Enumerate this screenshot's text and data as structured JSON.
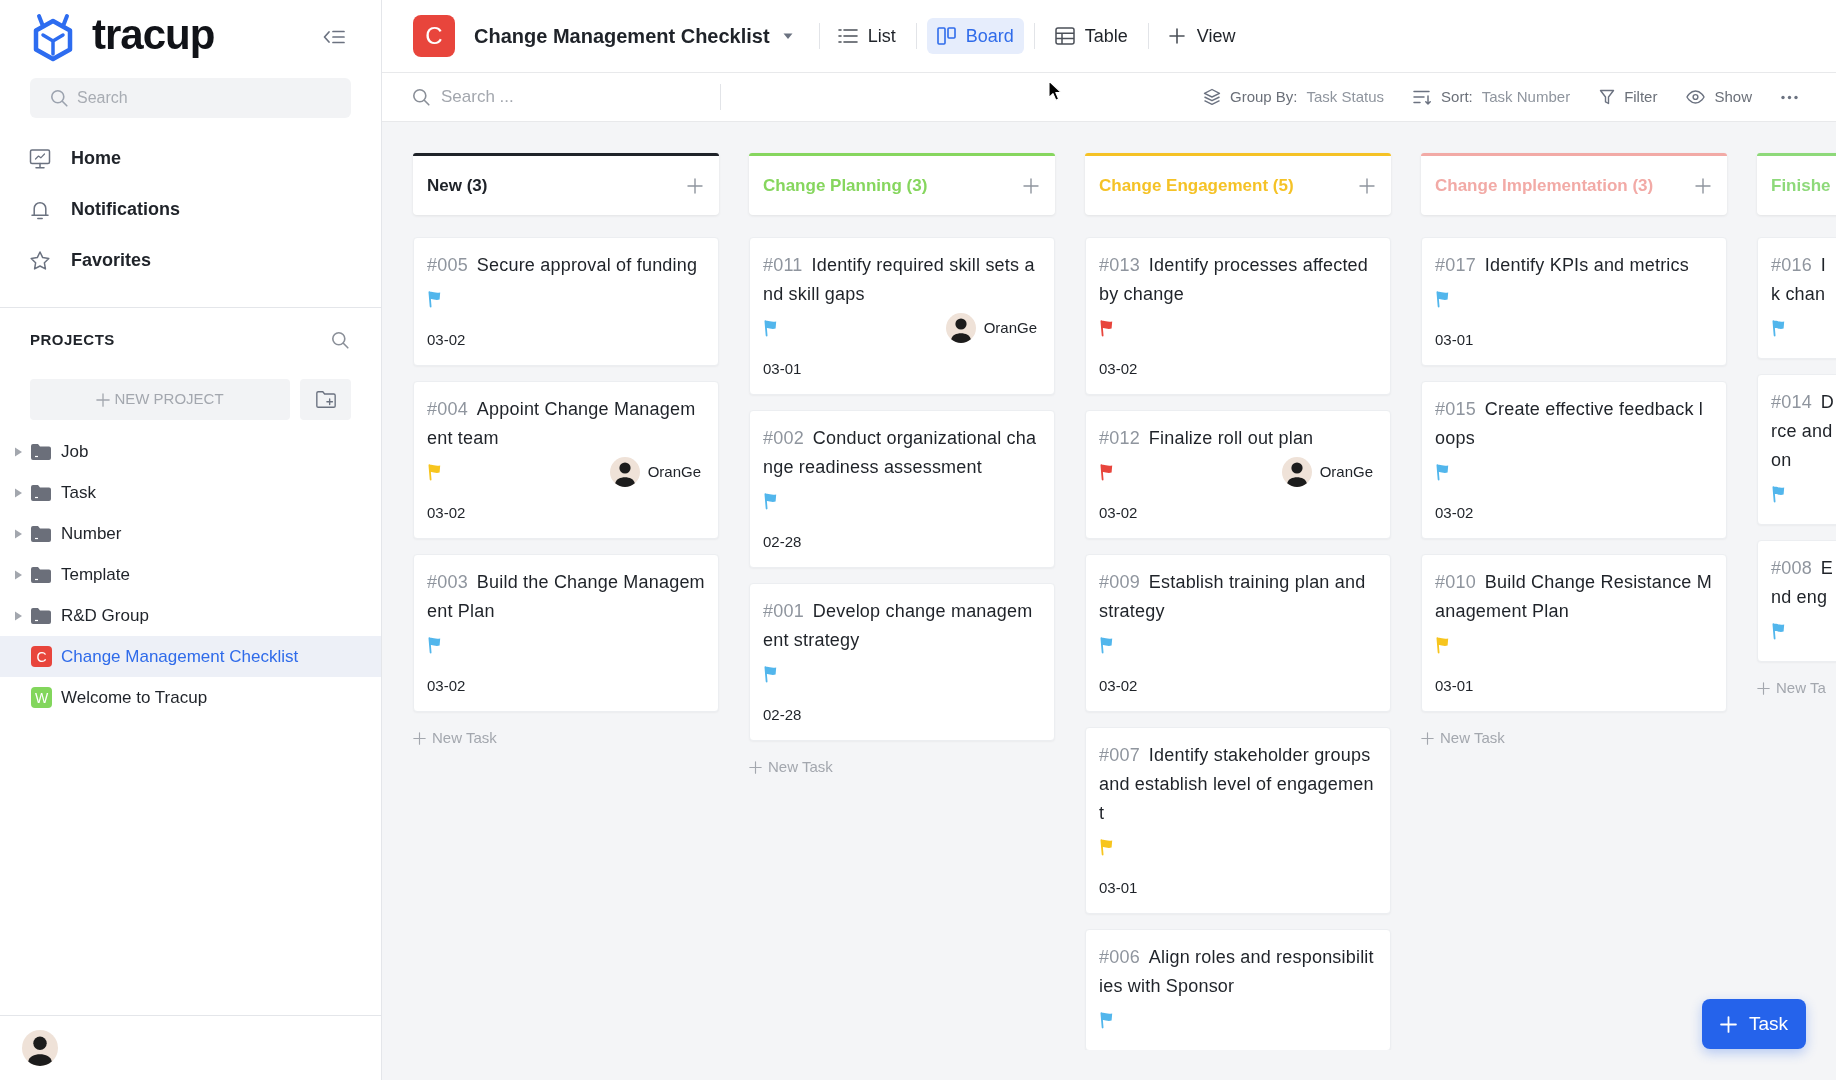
{
  "sidebar": {
    "logo": "tracup",
    "search": {
      "placeholder": "Search"
    },
    "nav": [
      {
        "label": "Home"
      },
      {
        "label": "Notifications"
      },
      {
        "label": "Favorites"
      }
    ],
    "projects": {
      "heading": "PROJECTS",
      "new_project": "NEW PROJECT",
      "items": [
        {
          "kind": "folder",
          "label": "Job",
          "expanded": false,
          "selected": false
        },
        {
          "kind": "folder",
          "label": "Task",
          "expanded": false,
          "selected": false
        },
        {
          "kind": "folder",
          "label": "Number",
          "expanded": false,
          "selected": false
        },
        {
          "kind": "folder",
          "label": "Template",
          "expanded": false,
          "selected": false
        },
        {
          "kind": "folder",
          "label": "R&D Group",
          "expanded": false,
          "selected": false
        },
        {
          "kind": "project",
          "letter": "C",
          "color": "#e8453c",
          "label": "Change Management Checklist",
          "selected": true
        },
        {
          "kind": "project",
          "letter": "W",
          "color": "#82d65c",
          "label": "Welcome to Tracup",
          "selected": false
        }
      ]
    }
  },
  "header": {
    "letter": "C",
    "title": "Change Management Checklist",
    "views": [
      {
        "label": "List",
        "selected": false
      },
      {
        "label": "Board",
        "selected": true
      },
      {
        "label": "Table",
        "selected": false
      }
    ],
    "add_view": "View"
  },
  "toolbar": {
    "search": {
      "placeholder": "Search ..."
    },
    "group_by": {
      "label": "Group By:",
      "value": "Task Status"
    },
    "sort": {
      "label": "Sort:",
      "value": "Task Number"
    },
    "filter": "Filter",
    "show": "Show"
  },
  "board": {
    "columns": [
      {
        "title": "New (3)",
        "color": "#1f2329",
        "cards": [
          {
            "number": "#005",
            "title": "Secure approval of funding",
            "flag": {
              "color": "#52b6ec"
            },
            "date": "03-02"
          },
          {
            "number": "#004",
            "title": "Appoint Change Management team",
            "flag": {
              "color": "#f7c51e"
            },
            "assignee": "OranGe",
            "date": "03-02"
          },
          {
            "number": "#003",
            "title": "Build the Change Management Plan",
            "flag": {
              "color": "#52b6ec"
            },
            "date": "03-02"
          }
        ],
        "new_task": "New Task"
      },
      {
        "title": "Change Planning (3)",
        "color": "#86d65e",
        "cards": [
          {
            "number": "#011",
            "title": "Identify required skill sets and skill gaps",
            "flag": {
              "color": "#52b6ec"
            },
            "assignee": "OranGe",
            "date": "03-01"
          },
          {
            "number": "#002",
            "title": "Conduct organizational change readiness assessment",
            "flag": {
              "color": "#52b6ec"
            },
            "date": "02-28"
          },
          {
            "number": "#001",
            "title": "Develop change management strategy",
            "flag": {
              "color": "#52b6ec"
            },
            "date": "02-28"
          }
        ],
        "new_task": "New Task"
      },
      {
        "title": "Change Engagement (5)",
        "color": "#f5c226",
        "cards": [
          {
            "number": "#013",
            "title": "Identify processes affected by change",
            "flag": {
              "color": "#e8453c"
            },
            "date": "03-02"
          },
          {
            "number": "#012",
            "title": "Finalize roll out plan",
            "flag": {
              "color": "#e8453c"
            },
            "assignee": "OranGe",
            "date": "03-02"
          },
          {
            "number": "#009",
            "title": "Establish training plan and strategy",
            "flag": {
              "color": "#52b6ec"
            },
            "date": "03-02"
          },
          {
            "number": "#007",
            "title": "Identify stakeholder groups and establish level of engagement",
            "flag": {
              "color": "#f7c51e"
            },
            "date": "03-01"
          },
          {
            "number": "#006",
            "title": "Align roles and responsibilities with Sponsor",
            "flag": {
              "color": "#52b6ec"
            }
          }
        ]
      },
      {
        "title": "Change Implementation (3)",
        "color": "#f2aaa6",
        "cards": [
          {
            "number": "#017",
            "title": "Identify KPIs and metrics",
            "flag": {
              "color": "#52b6ec"
            },
            "date": "03-01"
          },
          {
            "number": "#015",
            "title": "Create effective feedback loops",
            "flag": {
              "color": "#52b6ec"
            },
            "date": "03-02"
          },
          {
            "number": "#010",
            "title": "Build Change Resistance Management Plan",
            "flag": {
              "color": "#f7c51e"
            },
            "date": "03-01"
          }
        ],
        "new_task": "New Task"
      },
      {
        "title": "Finishe",
        "color": "#8ed97a",
        "cards": [
          {
            "number": "#016",
            "title": "I\nk chan",
            "flag": {
              "color": "#52b6ec"
            }
          },
          {
            "number": "#014",
            "title": "D\nrce and\non",
            "flag": {
              "color": "#52b6ec"
            }
          },
          {
            "number": "#008",
            "title": "E\nnd eng",
            "flag": {
              "color": "#52b6ec"
            }
          }
        ],
        "new_task": "New Ta"
      }
    ]
  },
  "fab": "Task"
}
